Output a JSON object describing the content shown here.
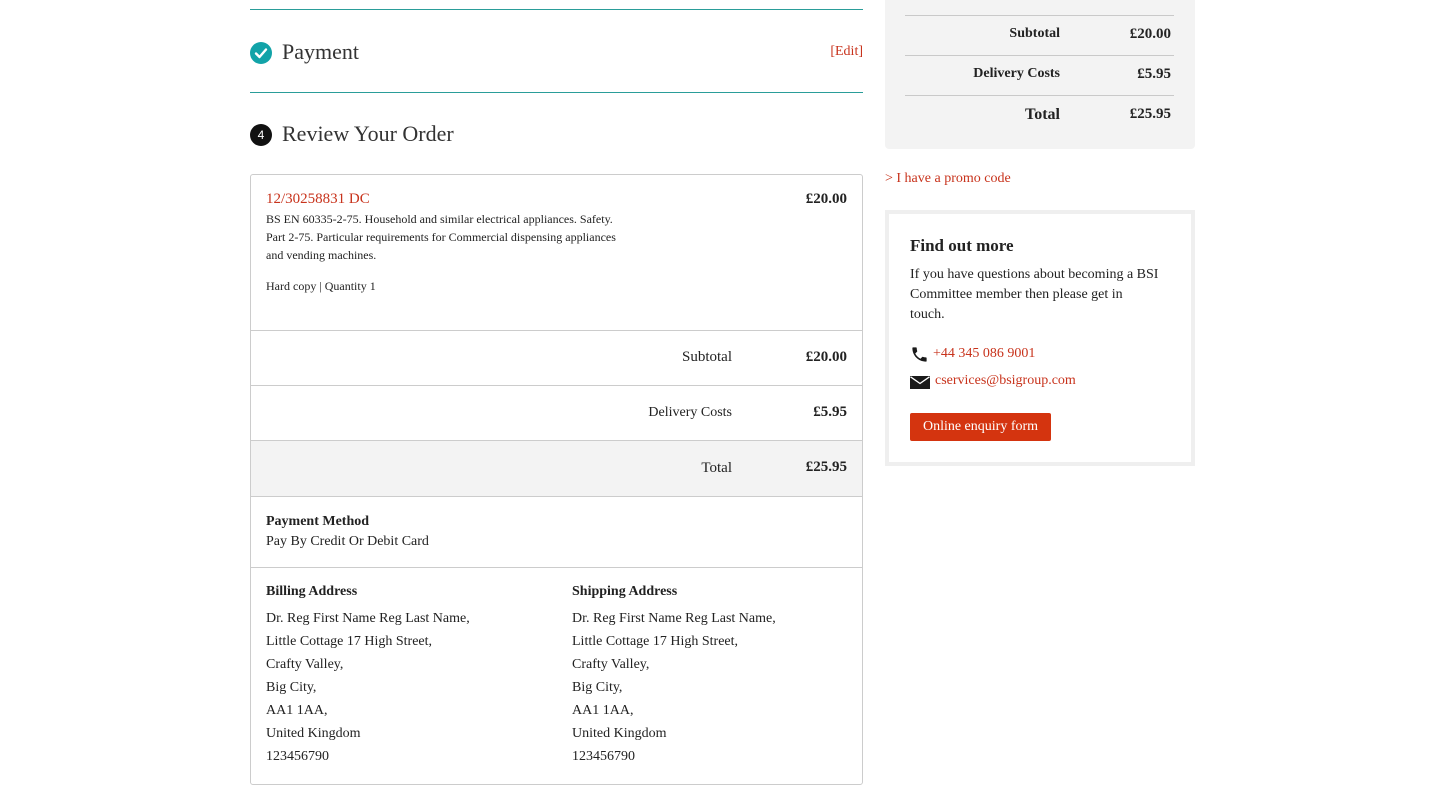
{
  "payment_step": {
    "title": "Payment",
    "edit_label": "[Edit]"
  },
  "review_step": {
    "number": "4",
    "title": "Review Your Order"
  },
  "order_item": {
    "code": "12/30258831 DC",
    "price": "£20.00",
    "description": "BS EN 60335-2-75. Household and similar electrical appliances. Safety. Part 2-75. Particular requirements for Commercial dispensing appliances and vending machines.",
    "format": "Hard copy",
    "separator": "|",
    "quantity": "Quantity 1"
  },
  "totals": {
    "subtotal_label": "Subtotal",
    "subtotal_value": "£20.00",
    "delivery_label": "Delivery Costs",
    "delivery_value": "£5.95",
    "total_label": "Total",
    "total_value": "£25.95"
  },
  "payment_method": {
    "label": "Payment Method",
    "value": "Pay By Credit Or Debit Card"
  },
  "billing": {
    "label": "Billing Address",
    "lines": [
      "Dr. Reg First Name Reg Last Name,",
      "Little Cottage 17 High Street,",
      "Crafty Valley,",
      "Big City,",
      "AA1 1AA,",
      "United Kingdom",
      "123456790"
    ]
  },
  "shipping": {
    "label": "Shipping Address",
    "lines": [
      "Dr. Reg First Name Reg Last Name,",
      "Little Cottage 17 High Street,",
      "Crafty Valley,",
      "Big City,",
      "AA1 1AA,",
      "United Kingdom",
      "123456790"
    ]
  },
  "sidebar_summary": {
    "subtotal_label": "Subtotal",
    "subtotal_value": "£20.00",
    "delivery_label": "Delivery Costs",
    "delivery_value": "£5.95",
    "total_label": "Total",
    "total_value": "£25.95"
  },
  "promo_link": "> I have a promo code",
  "find_out": {
    "title": "Find out more",
    "text": "If you have questions about becoming a BSI Committee member then please get in touch.",
    "phone": "+44 345 086 9001",
    "email": "cservices@bsigroup.com",
    "button": "Online enquiry form"
  },
  "icons": {
    "check": "check-circle-icon",
    "phone": "phone-icon",
    "mail": "mail-icon"
  },
  "colors": {
    "accent_teal": "#12a3a8",
    "link_red": "#c8331c",
    "button_red": "#d4340f"
  }
}
